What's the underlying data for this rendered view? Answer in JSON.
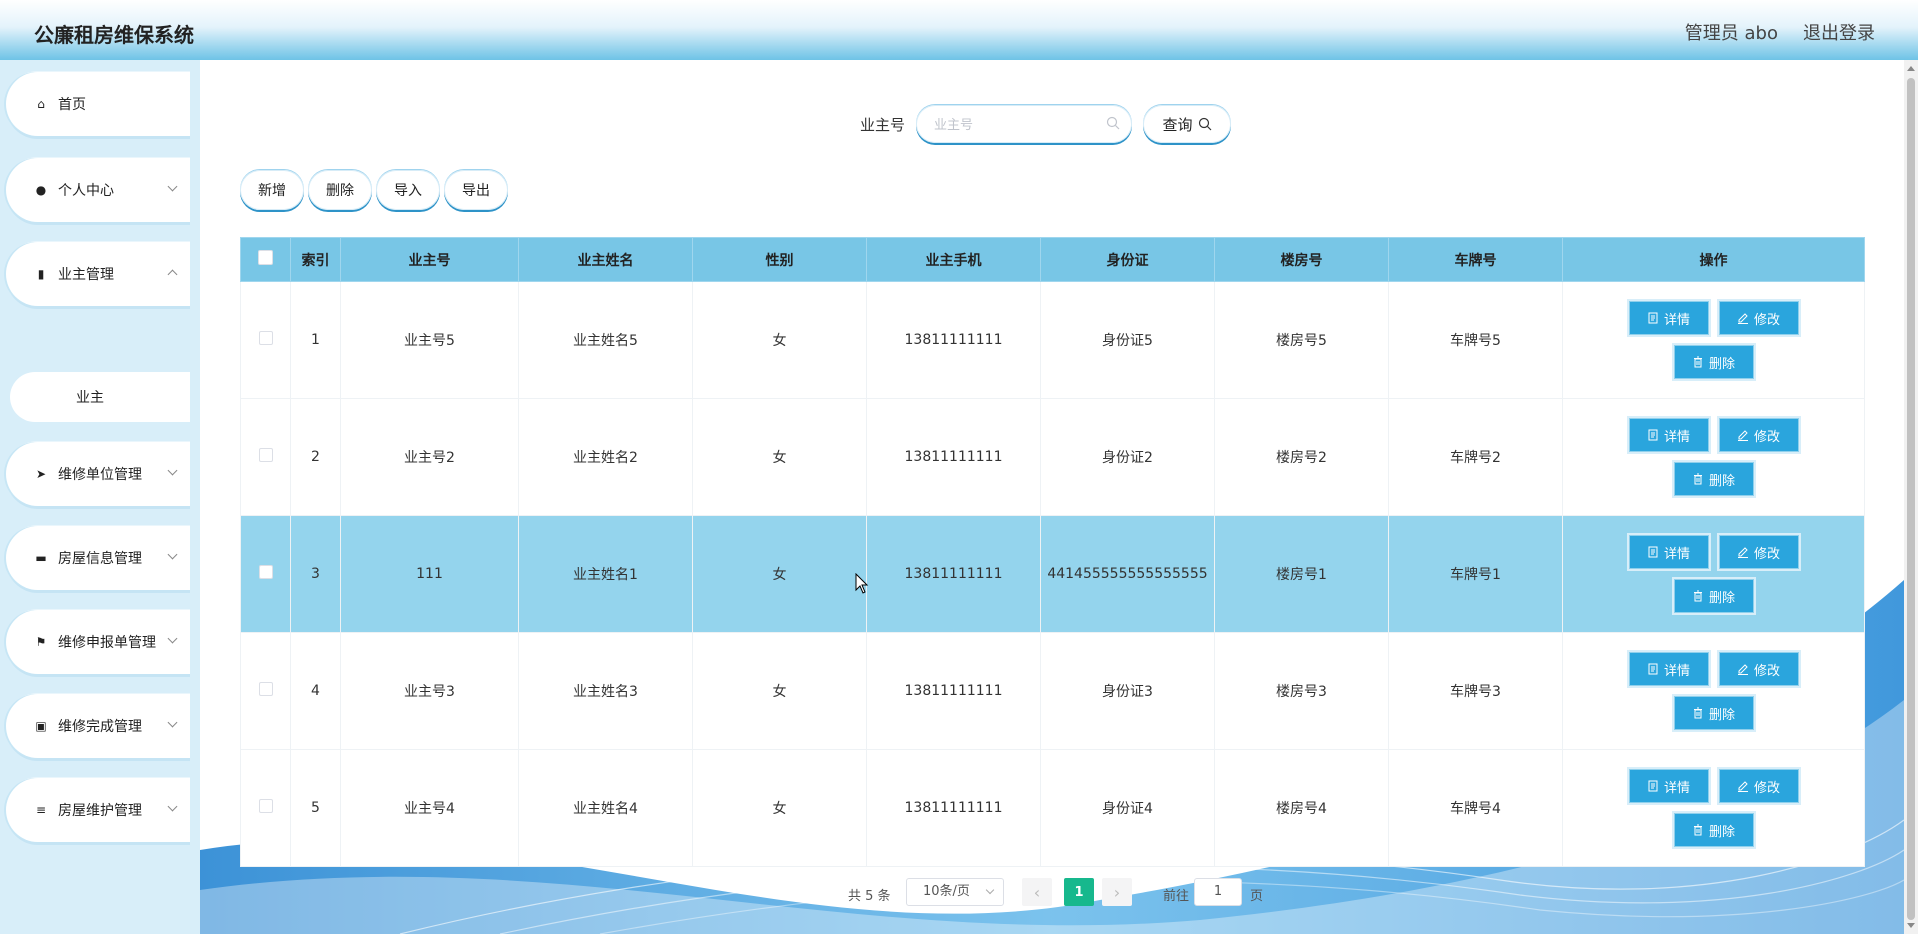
{
  "header": {
    "title": "公廉租房维保系统",
    "user": "管理员 abo",
    "logout": "退出登录"
  },
  "sidebar": {
    "items": [
      {
        "label": "首页",
        "icon": "home-icon",
        "glyph": "⌂"
      },
      {
        "label": "个人中心",
        "icon": "user-icon",
        "glyph": "●"
      },
      {
        "label": "业主管理",
        "icon": "bar-chart-icon",
        "glyph": "▮"
      },
      {
        "label": "维修单位管理",
        "icon": "send-icon",
        "glyph": "➤"
      },
      {
        "label": "房屋信息管理",
        "icon": "bed-icon",
        "glyph": "▬"
      },
      {
        "label": "维修申报单管理",
        "icon": "flag-icon",
        "glyph": "⚑"
      },
      {
        "label": "维修完成管理",
        "icon": "clipboard-icon",
        "glyph": "▣"
      },
      {
        "label": "房屋维护管理",
        "icon": "list-icon",
        "glyph": "≡"
      }
    ],
    "sub_item": "业主"
  },
  "search": {
    "label": "业主号",
    "placeholder": "业主号",
    "button": "查询"
  },
  "toolbar": {
    "add": "新增",
    "delete": "删除",
    "import": "导入",
    "export": "导出"
  },
  "table": {
    "headers": [
      "索引",
      "业主号",
      "业主姓名",
      "性别",
      "业主手机",
      "身份证",
      "楼房号",
      "车牌号",
      "操作"
    ],
    "rows": [
      {
        "index": "1",
        "owner_no": "业主号5",
        "name": "业主姓名5",
        "gender": "女",
        "phone": "13811111111",
        "id_card": "身份证5",
        "building": "楼房号5",
        "plate": "车牌号5"
      },
      {
        "index": "2",
        "owner_no": "业主号2",
        "name": "业主姓名2",
        "gender": "女",
        "phone": "13811111111",
        "id_card": "身份证2",
        "building": "楼房号2",
        "plate": "车牌号2"
      },
      {
        "index": "3",
        "owner_no": "111",
        "name": "业主姓名1",
        "gender": "女",
        "phone": "13811111111",
        "id_card": "441455555555555555",
        "building": "楼房号1",
        "plate": "车牌号1"
      },
      {
        "index": "4",
        "owner_no": "业主号3",
        "name": "业主姓名3",
        "gender": "女",
        "phone": "13811111111",
        "id_card": "身份证3",
        "building": "楼房号3",
        "plate": "车牌号3"
      },
      {
        "index": "5",
        "owner_no": "业主号4",
        "name": "业主姓名4",
        "gender": "女",
        "phone": "13811111111",
        "id_card": "身份证4",
        "building": "楼房号4",
        "plate": "车牌号4"
      }
    ],
    "actions": {
      "detail": "详情",
      "edit": "修改",
      "delete": "删除"
    }
  },
  "pagination": {
    "total": "共 5 条",
    "page_size": "10条/页",
    "current": "1",
    "goto": "前往",
    "goto_value": "1",
    "page_unit": "页"
  },
  "colors": {
    "header_accent": "#6ec3e6",
    "table_header": "#78c6e6",
    "action_button": "#2aa5dd",
    "current_page": "#17b88d",
    "highlight_row": "#94d4ed"
  }
}
